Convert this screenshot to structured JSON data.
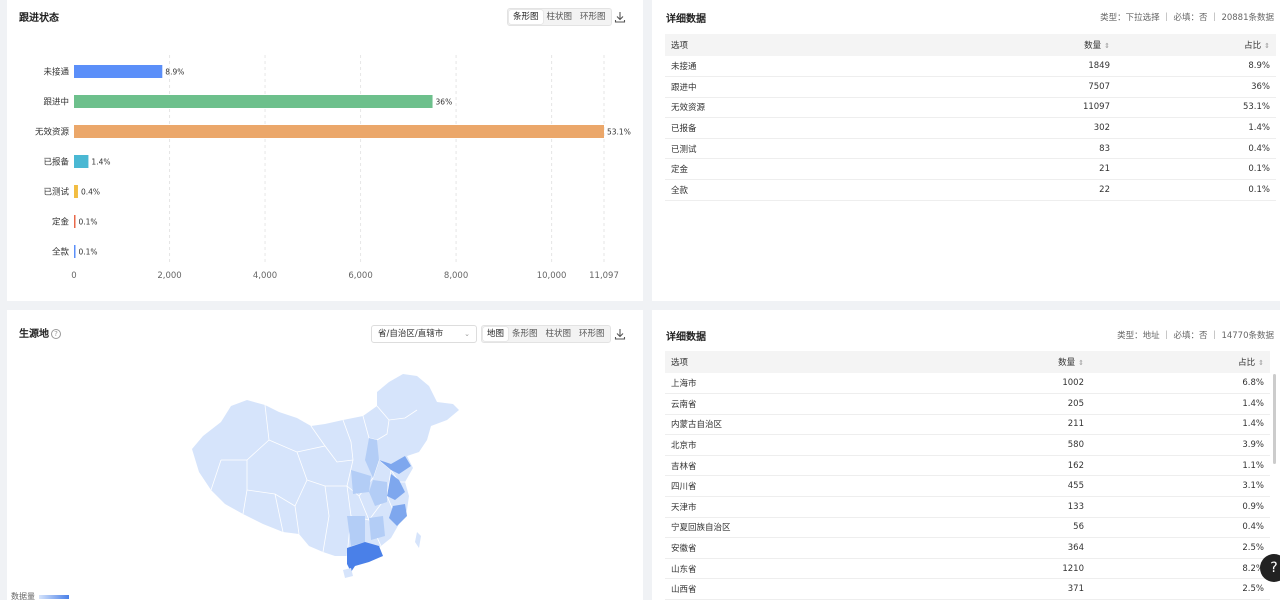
{
  "follow": {
    "title": "跟进状态",
    "chart_types": [
      "条形图",
      "柱状图",
      "环形图"
    ],
    "active_type": 0
  },
  "chart_data": {
    "type": "bar",
    "orientation": "horizontal",
    "categories": [
      "未接通",
      "跟进中",
      "无效资源",
      "已报备",
      "已测试",
      "定金",
      "全款"
    ],
    "values": [
      1849,
      7507,
      11097,
      302,
      83,
      21,
      22
    ],
    "data_labels": [
      "8.9%",
      "36%",
      "53.1%",
      "1.4%",
      "0.4%",
      "0.1%",
      "0.1%"
    ],
    "colors": [
      "#5b8ff9",
      "#6dc08c",
      "#eba76a",
      "#4ab8d3",
      "#f2bd42",
      "#e8684a",
      "#5b8ff9"
    ],
    "xlim": [
      0,
      11097
    ],
    "xticks": [
      0,
      2000,
      4000,
      6000,
      8000,
      10000,
      11097
    ],
    "xtick_labels": [
      "0",
      "2,000",
      "4,000",
      "6,000",
      "8,000",
      "10,000",
      "11,097"
    ],
    "grid": true
  },
  "detail1": {
    "title": "详细数据",
    "meta": "类型：下拉选择 ｜ 必填：否 ｜ 20881条数据",
    "headers": [
      "选项",
      "数量",
      "占比"
    ],
    "rows": [
      [
        "未接通",
        "1849",
        "8.9%"
      ],
      [
        "跟进中",
        "7507",
        "36%"
      ],
      [
        "无效资源",
        "11097",
        "53.1%"
      ],
      [
        "已报备",
        "302",
        "1.4%"
      ],
      [
        "已测试",
        "83",
        "0.4%"
      ],
      [
        "定金",
        "21",
        "0.1%"
      ],
      [
        "全款",
        "22",
        "0.1%"
      ]
    ]
  },
  "origin": {
    "title": "生源地",
    "help": "?",
    "select_value": "省/自治区/直辖市",
    "chart_types": [
      "地图",
      "条形图",
      "柱状图",
      "环形图"
    ],
    "active_type": 0,
    "map_colors": {
      "base": "#d6e4fb",
      "light": "#b3cdf6",
      "mid": "#7ea7ee",
      "dark": "#4a80e8",
      "border": "#ffffff"
    },
    "legend_label": "数据量"
  },
  "detail2": {
    "title": "详细数据",
    "meta": "类型：地址 ｜ 必填：否 ｜ 14770条数据",
    "headers": [
      "选项",
      "数量",
      "占比"
    ],
    "rows": [
      [
        "上海市",
        "1002",
        "6.8%"
      ],
      [
        "云南省",
        "205",
        "1.4%"
      ],
      [
        "内蒙古自治区",
        "211",
        "1.4%"
      ],
      [
        "北京市",
        "580",
        "3.9%"
      ],
      [
        "吉林省",
        "162",
        "1.1%"
      ],
      [
        "四川省",
        "455",
        "3.1%"
      ],
      [
        "天津市",
        "133",
        "0.9%"
      ],
      [
        "宁夏回族自治区",
        "56",
        "0.4%"
      ],
      [
        "安徽省",
        "364",
        "2.5%"
      ],
      [
        "山东省",
        "1210",
        "8.2%"
      ],
      [
        "山西省",
        "371",
        "2.5%"
      ]
    ]
  },
  "help_fab": "?"
}
